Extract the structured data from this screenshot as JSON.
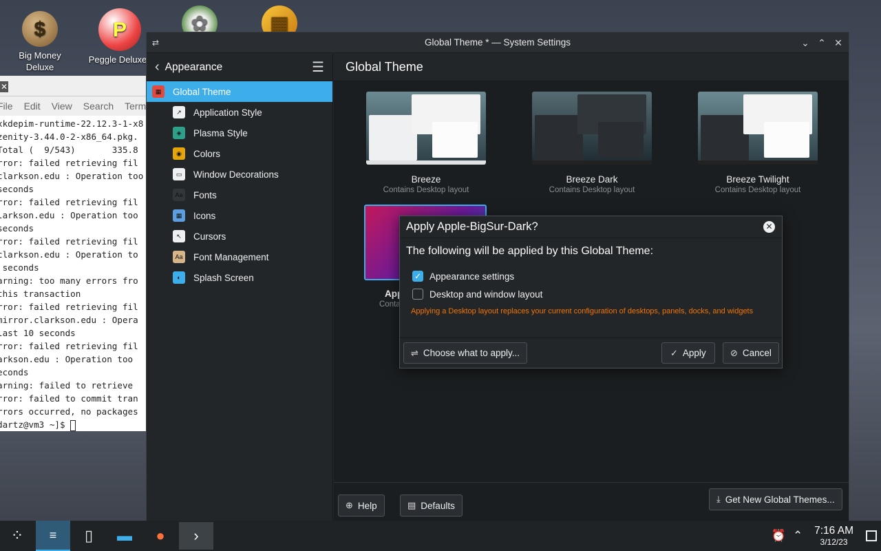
{
  "desktop": {
    "icons": [
      {
        "label": "Big Money Deluxe",
        "glyph": "$"
      },
      {
        "label": "Peggle Deluxe",
        "glyph": "P"
      },
      {
        "label": "",
        "glyph": "✿"
      },
      {
        "label": "",
        "glyph": "▦"
      }
    ]
  },
  "terminal": {
    "menu": [
      "File",
      "Edit",
      "View",
      "Search",
      "Terminal"
    ],
    "lines": [
      "xkdepim-runtime-22.12.3-1-x8",
      "zenity-3.44.0-2-x86_64.pkg.",
      "Total (  9/543)       335.8",
      "rror: failed retrieving fil",
      "clarkson.edu : Operation too",
      "seconds",
      "rror: failed retrieving fil",
      "larkson.edu : Operation too",
      "seconds",
      "rror: failed retrieving fil",
      "clarkson.edu : Operation to",
      " seconds",
      "arning: too many errors fro",
      "this transaction",
      "rror: failed retrieving fil",
      "mirror.clarkson.edu : Opera",
      "last 10 seconds",
      "rror: failed retrieving fil",
      "arkson.edu : Operation too",
      "econds",
      "arning: failed to retrieve",
      "rror: failed to commit tran",
      "rrors occurred, no packages",
      "dartz@vm3 ~]$ "
    ]
  },
  "window": {
    "title": "Global Theme * — System Settings",
    "sidebar": {
      "title": "Appearance",
      "items": [
        {
          "label": "Global Theme",
          "color": "#e04a3f"
        },
        {
          "label": "Application Style",
          "color": "#eef0f1"
        },
        {
          "label": "Plasma Style",
          "color": "#2ea089"
        },
        {
          "label": "Colors",
          "color": "#e5a50a"
        },
        {
          "label": "Window Decorations",
          "color": "#eef0f1"
        },
        {
          "label": "Fonts",
          "color": "#31363b"
        },
        {
          "label": "Icons",
          "color": "#5c9ee0"
        },
        {
          "label": "Cursors",
          "color": "#eef0f1"
        },
        {
          "label": "Font Management",
          "color": "#d8b48a"
        },
        {
          "label": "Splash Screen",
          "color": "#3daee9"
        }
      ]
    },
    "main": {
      "heading": "Global Theme",
      "themes": [
        {
          "name": "Breeze",
          "sub": "Contains Desktop layout"
        },
        {
          "name": "Breeze Dark",
          "sub": "Contains Desktop layout"
        },
        {
          "name": "Breeze Twilight",
          "sub": "Contains Desktop layout"
        },
        {
          "name": "App",
          "sub": "Conta"
        }
      ],
      "get_new": "Get New Global Themes...",
      "help": "Help",
      "defaults": "Defaults"
    }
  },
  "dialog": {
    "title": "Apply Apple-BigSur-Dark?",
    "lead": "The following will be applied by this Global Theme:",
    "options": [
      {
        "label": "Appearance settings",
        "checked": true
      },
      {
        "label": "Desktop and window layout",
        "checked": false
      }
    ],
    "warning": "Applying a Desktop layout replaces your current configuration of desktops, panels, docks, and widgets",
    "choose": "Choose what to apply...",
    "apply": "Apply",
    "cancel": "Cancel"
  },
  "taskbar": {
    "time": "7:16 AM",
    "date": "3/12/23"
  },
  "colors": {
    "accent": "#3daee9",
    "warning": "#f67400"
  }
}
